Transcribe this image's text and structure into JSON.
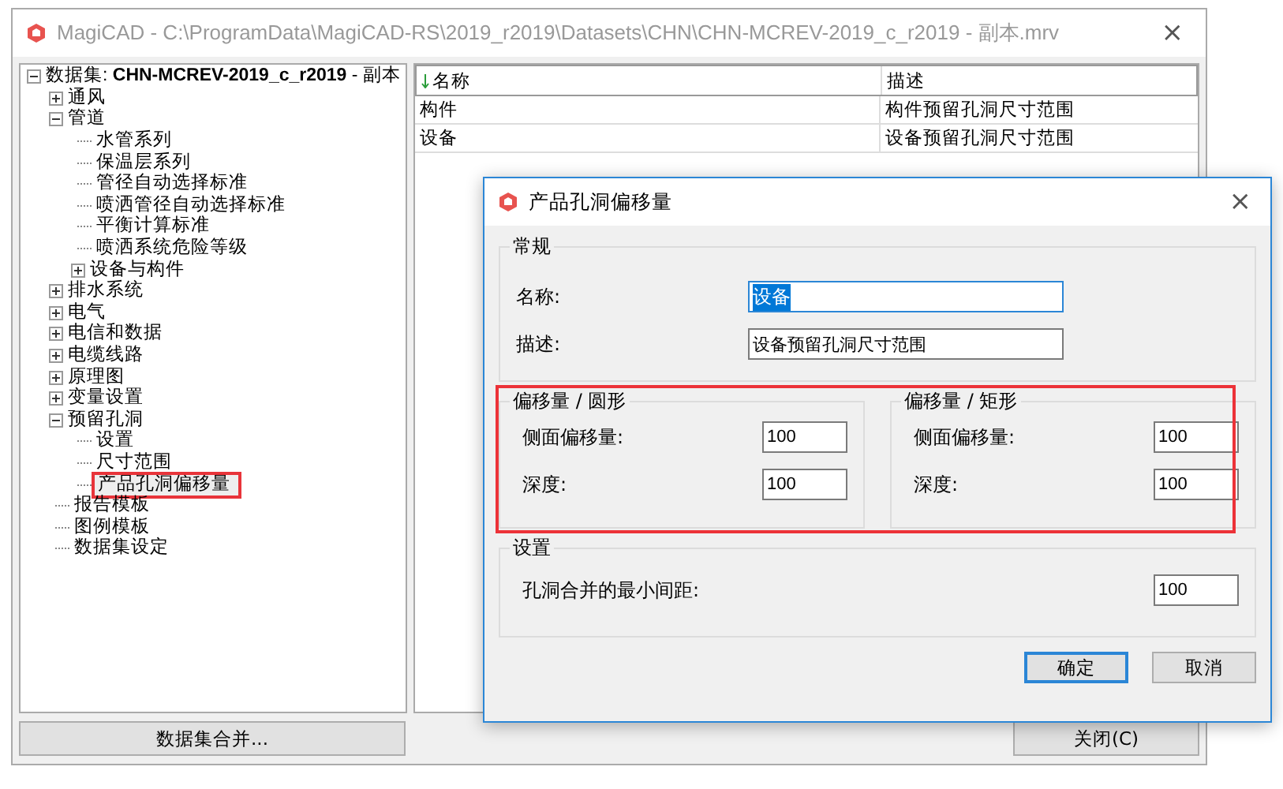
{
  "window": {
    "title": "MagiCAD - C:\\ProgramData\\MagiCAD-RS\\2019_r2019\\Datasets\\CHN\\CHN-MCREV-2019_c_r2019 - 副本.mrv",
    "close": "×"
  },
  "tree": [
    {
      "label": "数据集: **CHN-MCREV-2019_c_r2019** - 副本",
      "kind": "folder",
      "expanded": true,
      "children": [
        {
          "label": "通风",
          "kind": "folder",
          "expanded": false
        },
        {
          "label": "管道",
          "kind": "folder",
          "expanded": true,
          "children": [
            {
              "label": "水管系列",
              "kind": "leaf"
            },
            {
              "label": "保温层系列",
              "kind": "leaf"
            },
            {
              "label": "管径自动选择标准",
              "kind": "leaf"
            },
            {
              "label": "喷洒管径自动选择标准",
              "kind": "leaf"
            },
            {
              "label": "平衡计算标准",
              "kind": "leaf"
            },
            {
              "label": "喷洒系统危险等级",
              "kind": "leaf"
            },
            {
              "label": "设备与构件",
              "kind": "folder",
              "expanded": false
            }
          ]
        },
        {
          "label": "排水系统",
          "kind": "folder",
          "expanded": false
        },
        {
          "label": "电气",
          "kind": "folder",
          "expanded": false
        },
        {
          "label": "电信和数据",
          "kind": "folder",
          "expanded": false
        },
        {
          "label": "电缆线路",
          "kind": "folder",
          "expanded": false
        },
        {
          "label": "原理图",
          "kind": "folder",
          "expanded": false
        },
        {
          "label": "变量设置",
          "kind": "folder",
          "expanded": false
        },
        {
          "label": "预留孔洞",
          "kind": "folder",
          "expanded": true,
          "children": [
            {
              "label": "设置",
              "kind": "leaf"
            },
            {
              "label": "尺寸范围",
              "kind": "leaf"
            },
            {
              "label": "产品孔洞偏移量",
              "kind": "leaf",
              "highlighted": true
            }
          ]
        },
        {
          "label": "报告模板",
          "kind": "leaf"
        },
        {
          "label": "图例模板",
          "kind": "leaf"
        },
        {
          "label": "数据集设定",
          "kind": "leaf"
        }
      ]
    }
  ],
  "table": {
    "columns": [
      {
        "label": "名称",
        "sorted": true
      },
      {
        "label": "描述",
        "sorted": false
      }
    ],
    "rows": [
      [
        "构件",
        "构件预留孔洞尺寸范围"
      ],
      [
        "设备",
        "设备预留孔洞尺寸范围"
      ]
    ]
  },
  "merge_button": "数据集合并...",
  "close_button": "关闭(C)",
  "dialog": {
    "title": "产品孔洞偏移量",
    "close": "×",
    "general": {
      "title": "常规",
      "fields": [
        {
          "label": "名称:",
          "value": "设备",
          "text_selected": true
        },
        {
          "label": "描述:",
          "value": "设备预留孔洞尺寸范围",
          "text_selected": false
        }
      ]
    },
    "offsets_highlighted": true,
    "offset_groups": [
      {
        "title": "偏移量 / 圆形",
        "fields": [
          {
            "label": "侧面偏移量:",
            "value": "100"
          },
          {
            "label": "深度:",
            "value": "100"
          }
        ]
      },
      {
        "title": "偏移量 / 矩形",
        "fields": [
          {
            "label": "侧面偏移量:",
            "value": "100"
          },
          {
            "label": "深度:",
            "value": "100"
          }
        ]
      }
    ],
    "settings": {
      "title": "设置",
      "fields": [
        {
          "label": "孔洞合并的最小间距:",
          "value": "100"
        }
      ]
    },
    "buttons": [
      {
        "label": "确定",
        "default": true
      },
      {
        "label": "取消",
        "default": false
      }
    ]
  }
}
